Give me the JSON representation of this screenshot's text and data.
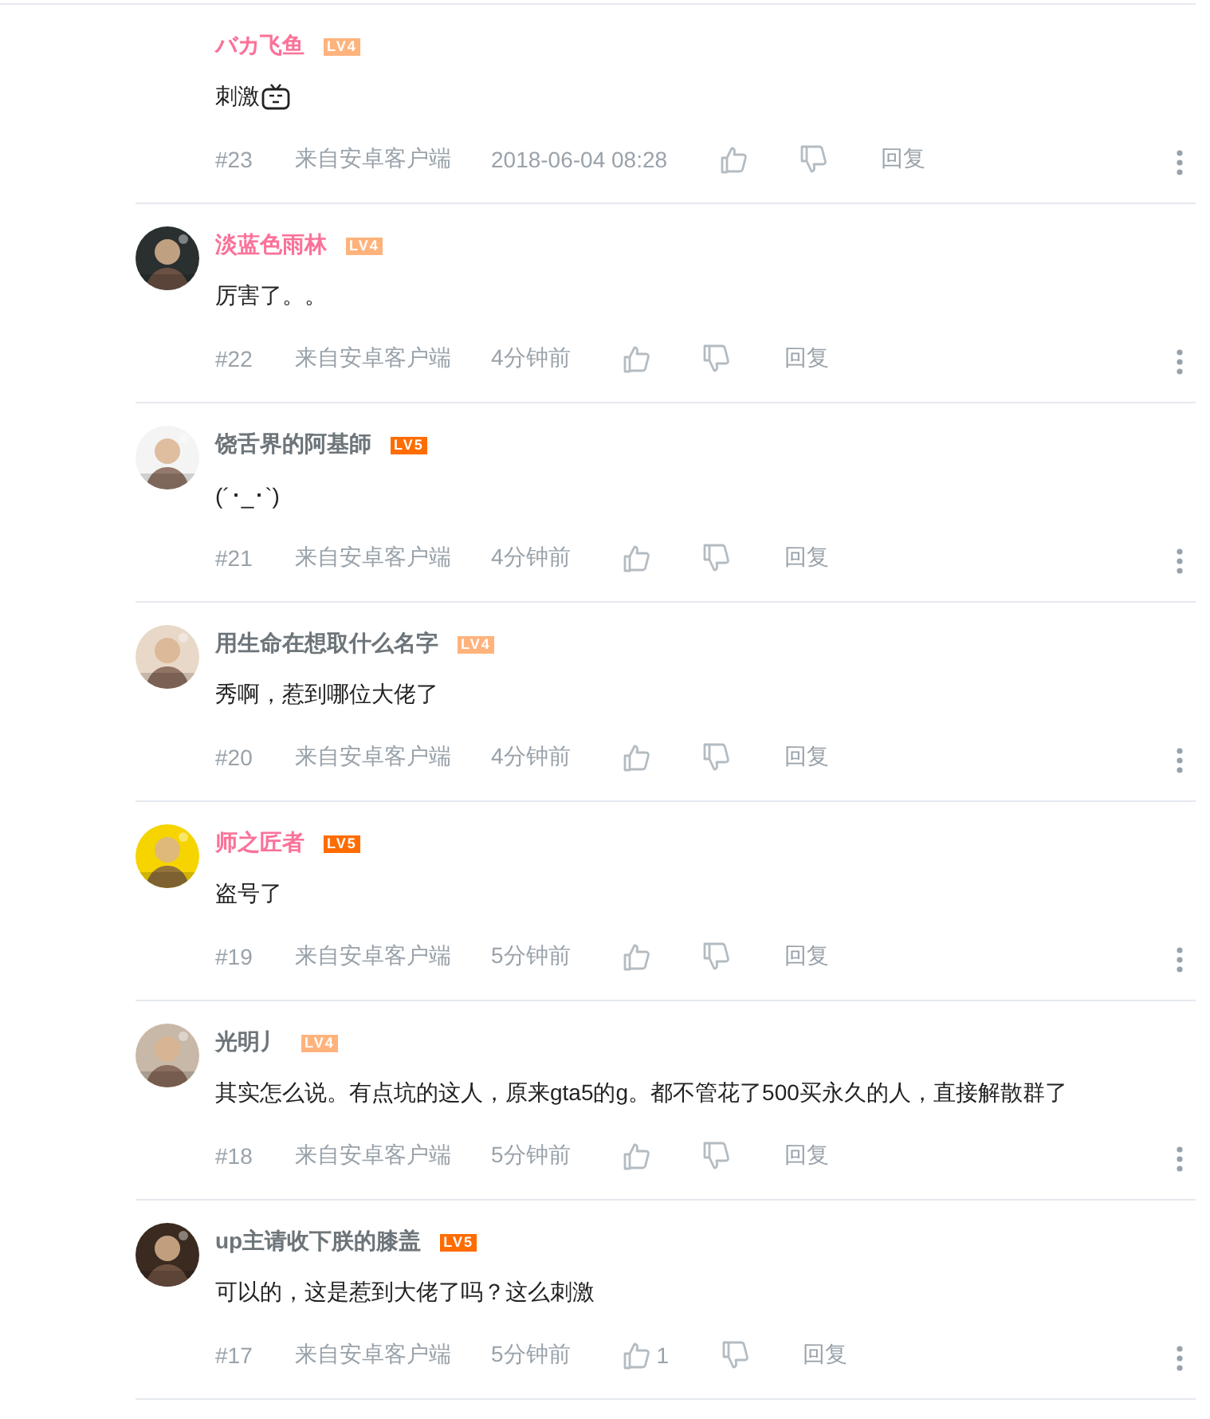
{
  "comments": [
    {
      "name": "バカ飞鱼",
      "vip": true,
      "badge": {
        "text": "LV4",
        "color": "#ffb37c"
      },
      "text": "刺激",
      "emote": {
        "kind": "tv"
      },
      "floor": "#23",
      "source": "来自安卓客户端",
      "time": "2018-06-04 08:28",
      "reply": "回复"
    },
    {
      "name": "淡蓝色雨林",
      "vip": true,
      "badge": {
        "text": "LV4",
        "color": "#ffb37c"
      },
      "text": "厉害了。。",
      "floor": "#22",
      "source": "来自安卓客户端",
      "time": "4分钟前",
      "reply": "回复"
    },
    {
      "name": "饶舌界的阿基師",
      "vip": false,
      "badge": {
        "text": "LV5",
        "color": "#ff6c00"
      },
      "text": "(´･_･`)",
      "floor": "#21",
      "source": "来自安卓客户端",
      "time": "4分钟前",
      "reply": "回复"
    },
    {
      "name": "用生命在想取什么名字",
      "vip": false,
      "badge": {
        "text": "LV4",
        "color": "#ffb37c"
      },
      "text": "秀啊，惹到哪位大佬了",
      "floor": "#20",
      "source": "来自安卓客户端",
      "time": "4分钟前",
      "reply": "回复"
    },
    {
      "name": "师之匠者",
      "vip": true,
      "badge": {
        "text": "LV5",
        "color": "#ff6c00"
      },
      "text": "盗号了",
      "floor": "#19",
      "source": "来自安卓客户端",
      "time": "5分钟前",
      "reply": "回复"
    },
    {
      "name": "光明丿",
      "vip": false,
      "badge": {
        "text": "LV4",
        "color": "#ffb37c"
      },
      "text": "其实怎么说。有点坑的这人，原来gta5的g。都不管花了500买永久的人，直接解散群了",
      "floor": "#18",
      "source": "来自安卓客户端",
      "time": "5分钟前",
      "reply": "回复"
    },
    {
      "name": "up主请收下朕的膝盖",
      "vip": false,
      "badge": {
        "text": "LV5",
        "color": "#ff6c00"
      },
      "text": "可以的，这是惹到大佬了吗？这么刺激",
      "floor": "#17",
      "source": "来自安卓客户端",
      "time": "5分钟前",
      "likes": "1",
      "reply": "回复"
    }
  ]
}
